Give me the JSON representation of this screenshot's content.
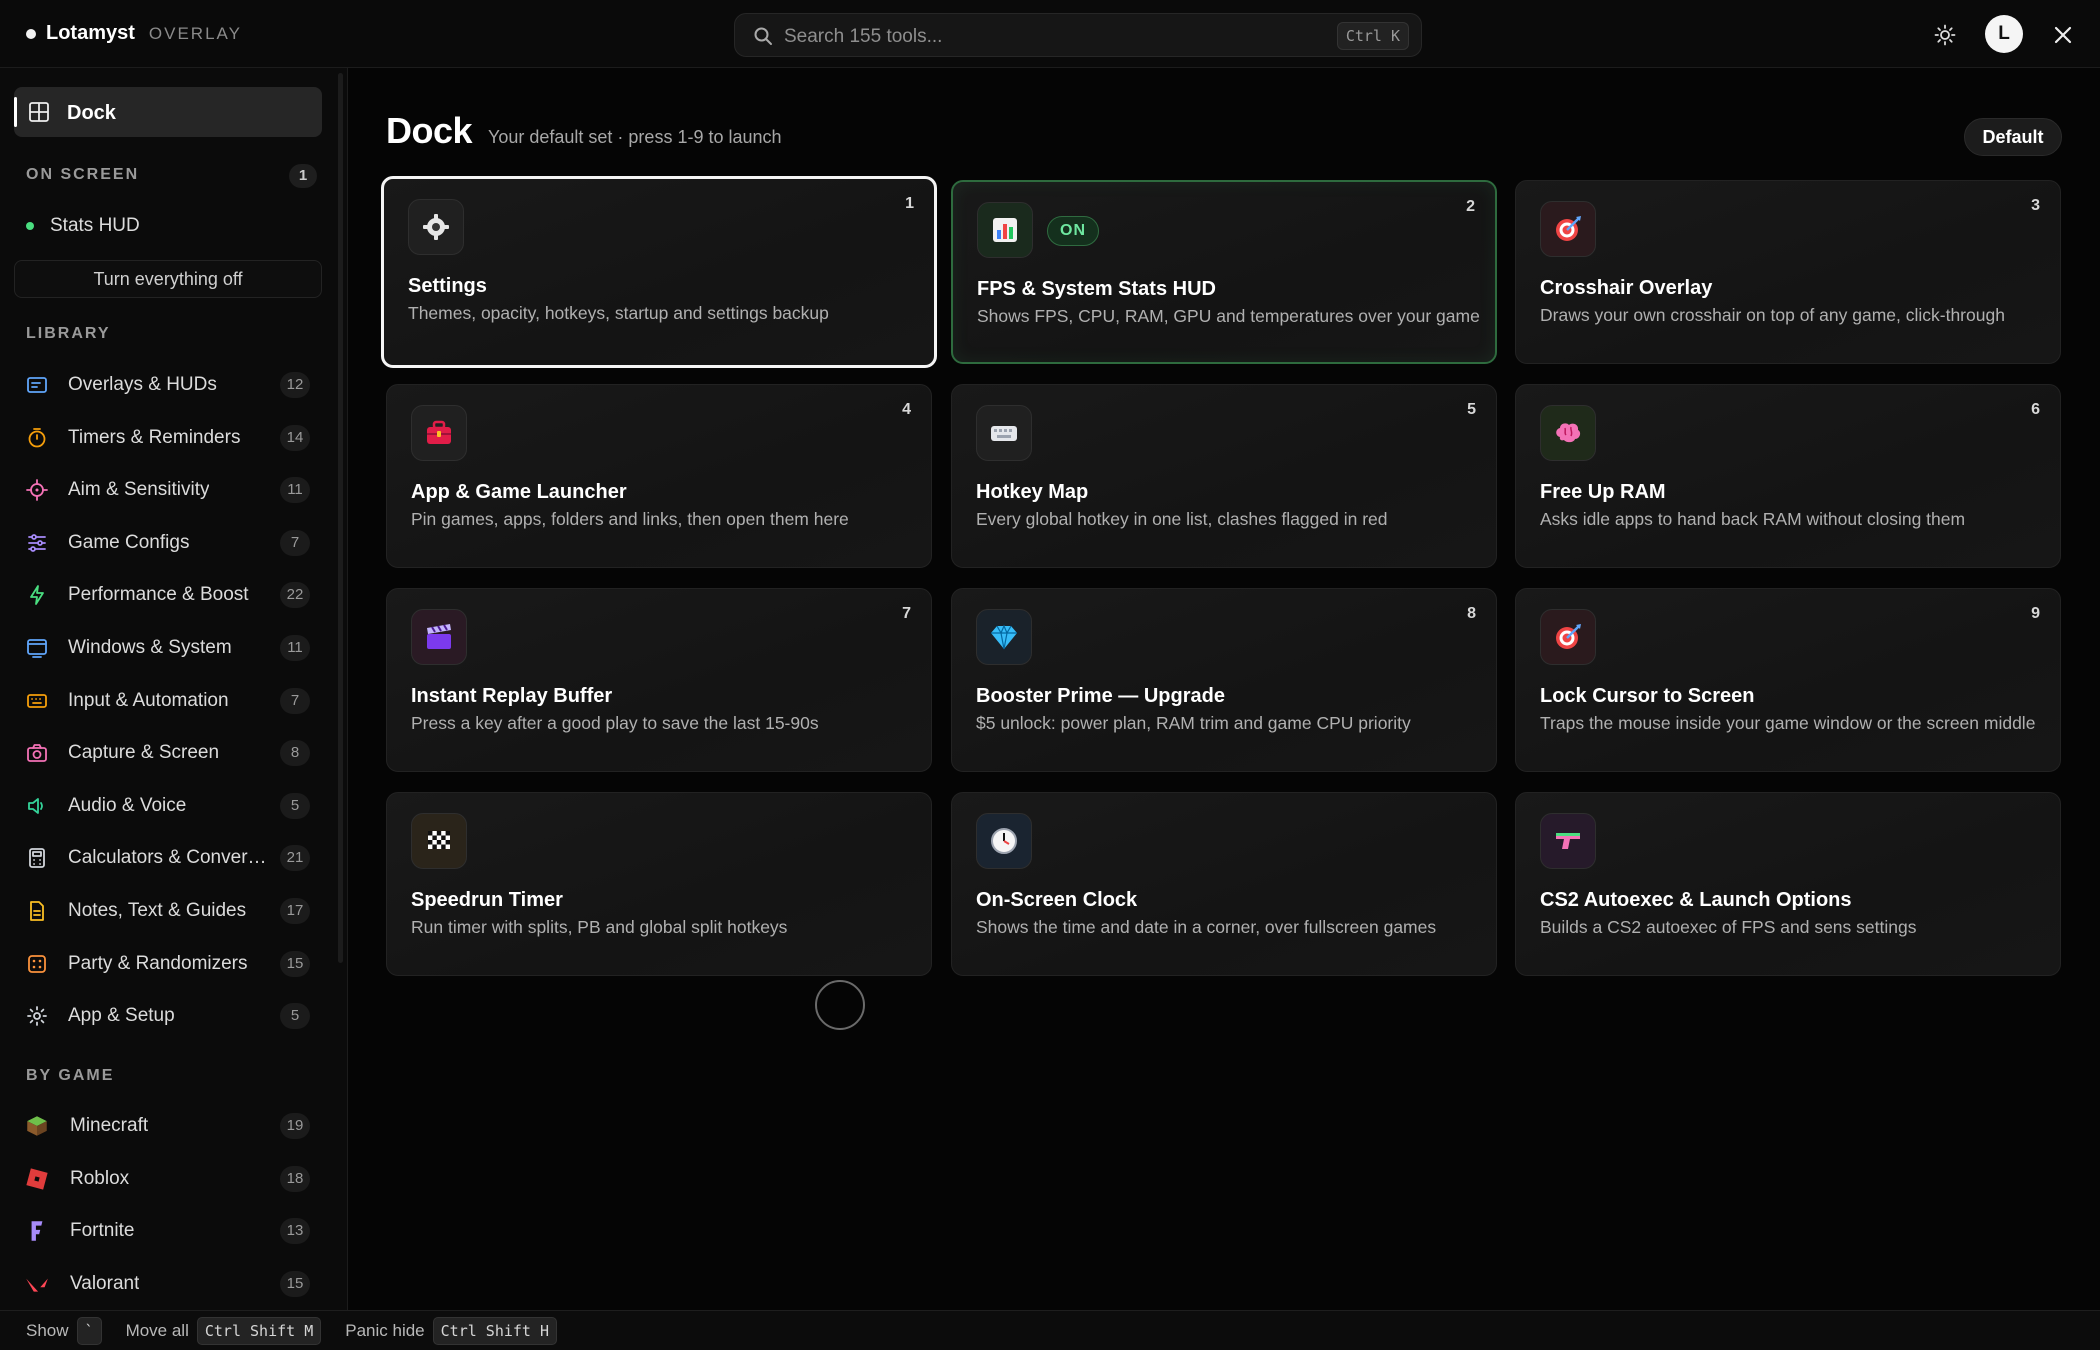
{
  "topbar": {
    "brand": "Lotamyst",
    "brand_sub": "OVERLAY",
    "search_placeholder": "Search 155 tools...",
    "search_shortcut": "Ctrl K",
    "avatar_initial": "L"
  },
  "sidebar": {
    "dock_label": "Dock",
    "on_screen": {
      "heading": "ON SCREEN",
      "count": "1",
      "items": [
        "Stats HUD"
      ],
      "turn_off_label": "Turn everything off"
    },
    "library": {
      "heading": "LIBRARY",
      "items": [
        {
          "label": "Overlays & HUDs",
          "count": "12",
          "icon": "overlay-icon",
          "color": "#60a5fa"
        },
        {
          "label": "Timers & Reminders",
          "count": "14",
          "icon": "timer-icon",
          "color": "#f59e0b"
        },
        {
          "label": "Aim & Sensitivity",
          "count": "11",
          "icon": "crosshair-icon",
          "color": "#f472b6"
        },
        {
          "label": "Game Configs",
          "count": "7",
          "icon": "sliders-icon",
          "color": "#a78bfa"
        },
        {
          "label": "Performance & Boost",
          "count": "22",
          "icon": "bolt-icon",
          "color": "#4ade80"
        },
        {
          "label": "Windows & System",
          "count": "11",
          "icon": "window-icon",
          "color": "#60a5fa"
        },
        {
          "label": "Input & Automation",
          "count": "7",
          "icon": "keyboard-icon",
          "color": "#f59e0b"
        },
        {
          "label": "Capture & Screen",
          "count": "8",
          "icon": "camera-icon",
          "color": "#f472b6"
        },
        {
          "label": "Audio & Voice",
          "count": "5",
          "icon": "speaker-icon",
          "color": "#34d399"
        },
        {
          "label": "Calculators & Converters",
          "count": "21",
          "icon": "calculator-icon",
          "color": "#d1d5db"
        },
        {
          "label": "Notes, Text & Guides",
          "count": "17",
          "icon": "note-icon",
          "color": "#fbbf24"
        },
        {
          "label": "Party & Randomizers",
          "count": "15",
          "icon": "dice-icon",
          "color": "#fb923c"
        },
        {
          "label": "App & Setup",
          "count": "5",
          "icon": "gear-icon",
          "color": "#d1d5db"
        }
      ]
    },
    "by_game": {
      "heading": "BY GAME",
      "items": [
        {
          "label": "Minecraft",
          "count": "19",
          "icon": "minecraft-icon"
        },
        {
          "label": "Roblox",
          "count": "18",
          "icon": "roblox-icon"
        },
        {
          "label": "Fortnite",
          "count": "13",
          "icon": "fortnite-icon"
        },
        {
          "label": "Valorant",
          "count": "15",
          "icon": "valorant-icon"
        }
      ]
    }
  },
  "main": {
    "title": "Dock",
    "subtitle": "Your default set · press 1-9 to launch",
    "default_label": "Default",
    "cards": [
      {
        "num": "1",
        "title": "Settings",
        "desc": "Themes, opacity, hotkeys, startup and settings backup",
        "icon": "gear-icon",
        "state": "selected"
      },
      {
        "num": "2",
        "title": "FPS & System Stats HUD",
        "desc": "Shows FPS, CPU, RAM, GPU and temperatures over your game",
        "icon": "bar-chart-icon",
        "state": "on",
        "badge": "ON"
      },
      {
        "num": "3",
        "title": "Crosshair Overlay",
        "desc": "Draws your own crosshair on top of any game, click-through",
        "icon": "target-icon",
        "state": ""
      },
      {
        "num": "4",
        "title": "App & Game Launcher",
        "desc": "Pin games, apps, folders and links, then open them here",
        "icon": "toolbox-icon",
        "state": ""
      },
      {
        "num": "5",
        "title": "Hotkey Map",
        "desc": "Every global hotkey in one list, clashes flagged in red",
        "icon": "keyboard-icon",
        "state": ""
      },
      {
        "num": "6",
        "title": "Free Up RAM",
        "desc": "Asks idle apps to hand back RAM without closing them",
        "icon": "brain-icon",
        "state": ""
      },
      {
        "num": "7",
        "title": "Instant Replay Buffer",
        "desc": "Press a key after a good play to save the last 15-90s",
        "icon": "clapper-icon",
        "state": ""
      },
      {
        "num": "8",
        "title": "Booster Prime — Upgrade",
        "desc": "$5 unlock: power plan, RAM trim and game CPU priority",
        "icon": "gem-icon",
        "state": ""
      },
      {
        "num": "9",
        "title": "Lock Cursor to Screen",
        "desc": "Traps the mouse inside your game window or the screen middle",
        "icon": "target-icon",
        "state": ""
      },
      {
        "num": "",
        "title": "Speedrun Timer",
        "desc": "Run timer with splits, PB and global split hotkeys",
        "icon": "checkered-flag-icon",
        "state": ""
      },
      {
        "num": "",
        "title": "On-Screen Clock",
        "desc": "Shows the time and date in a corner, over fullscreen games",
        "icon": "clock-icon",
        "state": ""
      },
      {
        "num": "",
        "title": "CS2 Autoexec & Launch Options",
        "desc": "Builds a CS2 autoexec of FPS and sens settings",
        "icon": "gun-icon",
        "state": ""
      }
    ]
  },
  "footer": {
    "show_label": "Show",
    "show_key": "`",
    "move_label": "Move all",
    "move_key": "Ctrl Shift M",
    "panic_label": "Panic hide",
    "panic_key": "Ctrl Shift H"
  }
}
